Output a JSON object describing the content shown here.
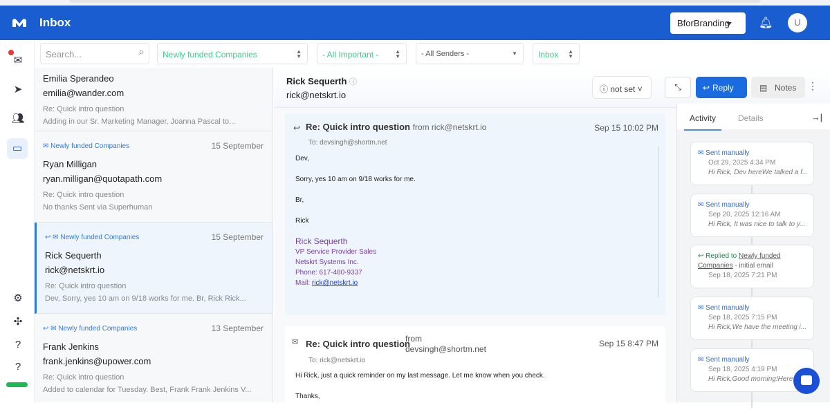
{
  "header": {
    "title": "Inbox",
    "brand": "BforBranding",
    "avatar": "U"
  },
  "filters": {
    "search_placeholder": "Search...",
    "campaign": "Newly funded Companies",
    "importance": "- All Important -",
    "senders": "- All Senders -",
    "folder": "Inbox"
  },
  "list": [
    {
      "tag": "",
      "date": "",
      "name": "Emilia Sperandeo",
      "email": "emilia@wander.com",
      "subject": "Re: Quick intro question",
      "preview": "Adding in our Sr. Marketing Manager, Joanna Pascal to..."
    },
    {
      "tag": "Newly funded Companies",
      "date": "15 September",
      "name": "Ryan Milligan",
      "email": "ryan.milligan@quotapath.com",
      "subject": "Re: Quick intro question",
      "preview": "No thanks Sent via Superhuman"
    },
    {
      "tag": "Newly funded Companies",
      "date": "15 September",
      "name": "Rick Sequerth",
      "email": "rick@netskrt.io",
      "subject": "Re: Quick intro question",
      "preview": "Dev, Sorry, yes 10 am on 9/18 works for me. Br, Rick Rick..."
    },
    {
      "tag": "Newly funded Companies",
      "date": "13 September",
      "name": "Frank Jenkins",
      "email": "frank.jenkins@upower.com",
      "subject": "Re: Quick intro question",
      "preview": "Added to calendar for Tuesday. Best, Frank Frank Jenkins V..."
    }
  ],
  "detail": {
    "name": "Rick Sequerth",
    "email": "rick@netskrt.io",
    "status": "not set",
    "reply": "Reply",
    "notes": "Notes",
    "messages": [
      {
        "subject": "Re: Quick intro question",
        "from": "from rick@netskrt.io",
        "date": "Sep 15 10:02 PM",
        "to": "To: devsingh@shortm.net",
        "body": [
          "Dev,",
          "Sorry, yes 10 am on 9/18 works for me.",
          "Br,",
          "Rick"
        ],
        "signature": {
          "name": "Rick Sequerth",
          "title": "VP Service Provider Sales",
          "company": "Netskrt Systems Inc.",
          "phone": "Phone: 617-480-9337",
          "mail_label": "Mail: ",
          "mail": "rick@netskrt.io"
        }
      },
      {
        "subject": "Re: Quick intro question",
        "from_label": "from",
        "from": "devsingh@shortm.net",
        "date": "Sep 15 8:47 PM",
        "to": "To: rick@netskrt.io",
        "body": [
          "Hi Rick, just a quick reminder on my last message. Let me know when you check.",
          "Thanks,"
        ]
      }
    ]
  },
  "activity": {
    "tabs": [
      "Activity",
      "Details"
    ],
    "items": [
      {
        "kind": "Sent manually",
        "date": "Oct 29, 2025 4:34 PM",
        "preview": "Hi Rick, Dev hereWe talked a f..."
      },
      {
        "kind": "Sent manually",
        "date": "Sep 20, 2025 12:16 AM",
        "preview": "Hi Rick, It was nice to talk to y..."
      },
      {
        "kind": "Replied to",
        "link": "Newly funded Companies",
        "suffix": " - initial email",
        "date": "Sep 18, 2025 7:21 PM"
      },
      {
        "kind": "Sent manually",
        "date": "Sep 18, 2025 7:15 PM",
        "preview": "Hi Rick,We have the meeting i..."
      },
      {
        "kind": "Sent manually",
        "date": "Sep 18, 2025 4:19 PM",
        "preview": "Hi Rick,Good morning!Here"
      }
    ]
  }
}
